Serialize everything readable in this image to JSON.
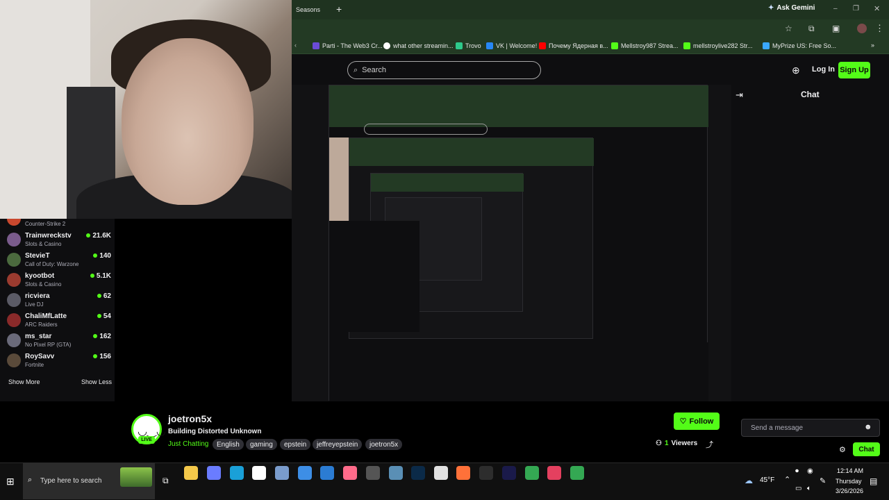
{
  "browser": {
    "tab_title": "Seasons",
    "new_tab_label": "+",
    "ask_gemini": "Ask Gemini",
    "bookmarks": [
      "Parti - The Web3 Cr...",
      "what other streamin...",
      "Trovo",
      "VK | Welcome!",
      "Почему Ядерная в...",
      "Mellstroy987 Strea...",
      "mellstroylive282 Str...",
      "MyPrize US: Free So..."
    ]
  },
  "header": {
    "search_placeholder": "Search",
    "login_label": "Log In",
    "signup_label": "Sign Up"
  },
  "chat": {
    "title": "Chat",
    "input_placeholder": "Send a message",
    "send_label": "Chat"
  },
  "sidebar": {
    "partial_item": "Counter-Strike 2",
    "items": [
      {
        "name": "Trainwreckstv",
        "category": "Slots & Casino",
        "viewers": "21.6K",
        "color": "#7a5b8c"
      },
      {
        "name": "StevieT",
        "category": "Call of Duty: Warzone",
        "viewers": "140",
        "color": "#4b6a3e"
      },
      {
        "name": "kyootbot",
        "category": "Slots & Casino",
        "viewers": "5.1K",
        "color": "#9b3b2f"
      },
      {
        "name": "ricviera",
        "category": "Live DJ",
        "viewers": "62",
        "color": "#5b5b66"
      },
      {
        "name": "ChaliMfLatte",
        "category": "ARC Raiders",
        "viewers": "54",
        "color": "#8a2a2a"
      },
      {
        "name": "ms_star",
        "category": "No Pixel RP (GTA)",
        "viewers": "162",
        "color": "#6a6a7a"
      },
      {
        "name": "RoySavv",
        "category": "Fortnite",
        "viewers": "156",
        "color": "#5a4a3a"
      }
    ],
    "show_more": "Show More",
    "show_less": "Show Less"
  },
  "stream": {
    "channel": "joetron5x",
    "live_badge": "LIVE",
    "title": "Building Distorted Unknown",
    "category": "Just Chatting",
    "tags": [
      "English",
      "gaming",
      "epstein",
      "jeffreyepstein",
      "joetron5x"
    ],
    "follow_label": "Follow",
    "viewers_count": "1",
    "viewers_label": "Viewers"
  },
  "taskbar": {
    "search_placeholder": "Type here to search",
    "weather": "45°F",
    "time": "12:14 AM",
    "day": "Thursday",
    "date": "3/26/2026"
  },
  "colors": {
    "accent": "#53fc18",
    "background": "#0e0e10",
    "chrome": "#233a24"
  }
}
